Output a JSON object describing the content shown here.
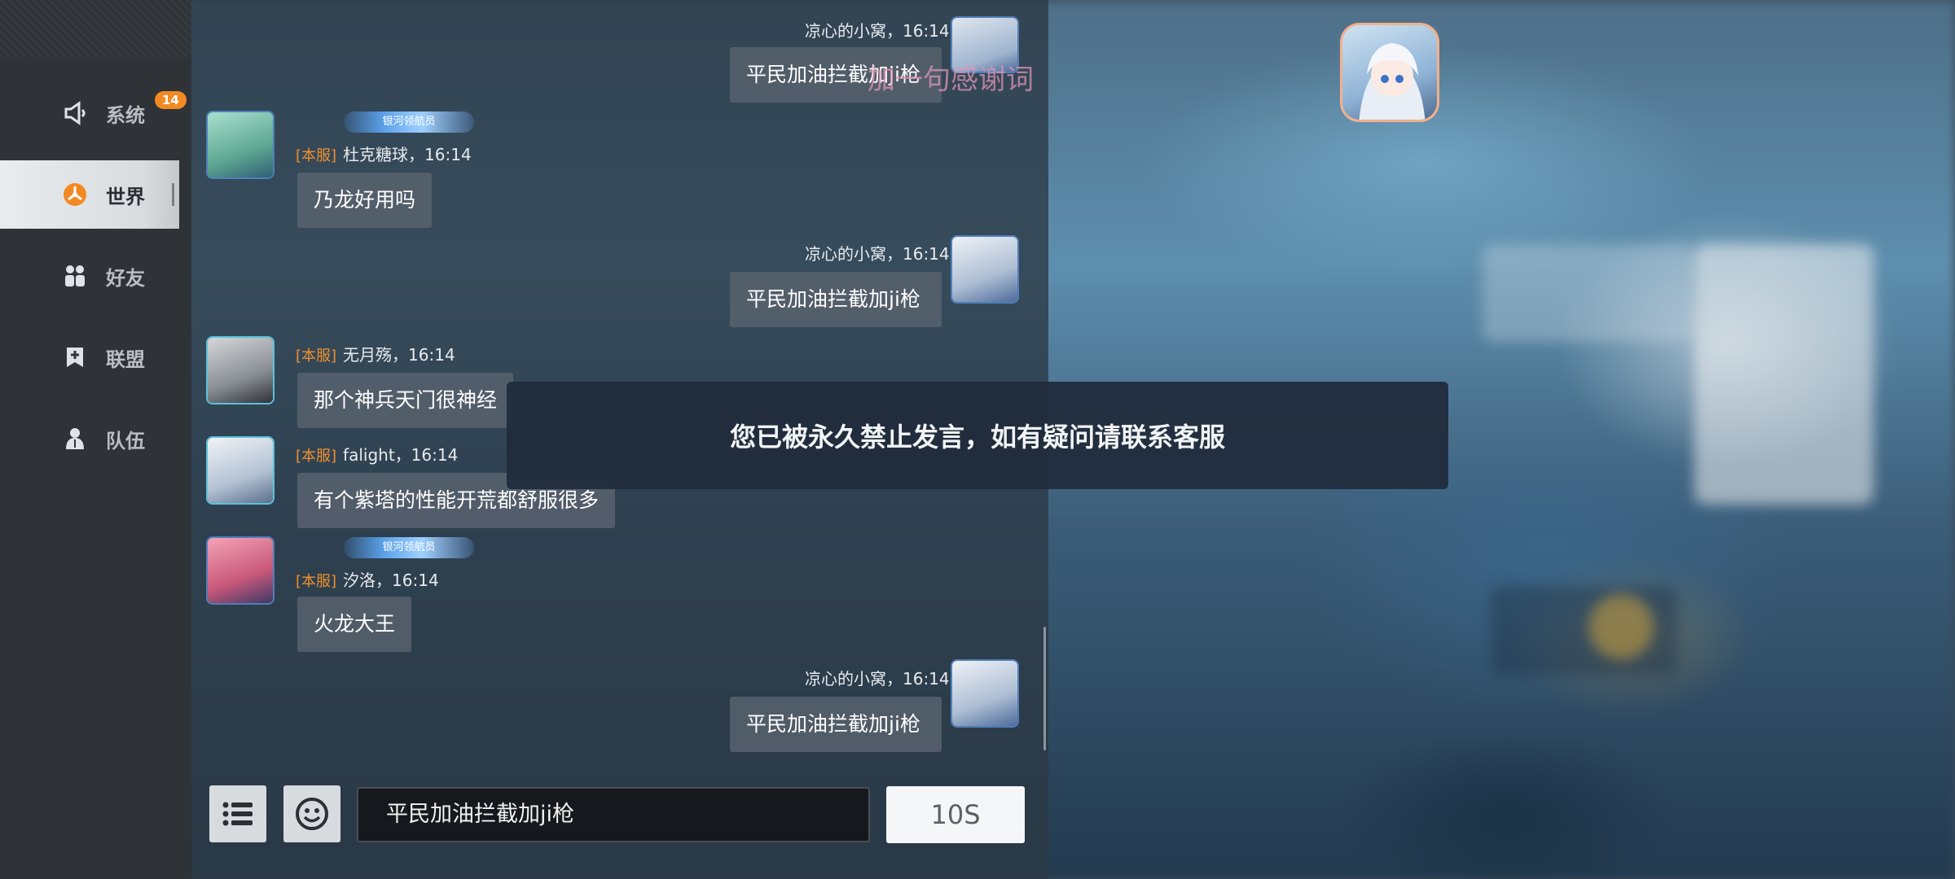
{
  "sidebar": {
    "items": [
      {
        "label": "系统",
        "icon": "speaker-icon",
        "badge": "14"
      },
      {
        "label": "世界",
        "icon": "world-icon",
        "active": true
      },
      {
        "label": "好友",
        "icon": "friends-icon"
      },
      {
        "label": "联盟",
        "icon": "alliance-icon"
      },
      {
        "label": "队伍",
        "icon": "team-icon"
      }
    ]
  },
  "overlay_text": "加一句感谢词",
  "messages": [
    {
      "meta": "凉心的小窝，16:14",
      "text": "平民加油拦截加ji枪",
      "side": "right"
    },
    {
      "tag": "[本服]",
      "meta": "杜克糖球，16:14",
      "text": "乃龙好用吗",
      "side": "left",
      "title_badge": "银河领航员"
    },
    {
      "meta": "凉心的小窝，16:14",
      "text": "平民加油拦截加ji枪",
      "side": "right"
    },
    {
      "tag": "[本服]",
      "meta": "无月殇，16:14",
      "text": "那个神兵天门很神经",
      "side": "left"
    },
    {
      "tag": "[本服]",
      "meta": "falight，16:14",
      "text": "有个紫塔的性能开荒都舒服很多",
      "side": "left"
    },
    {
      "tag": "[本服]",
      "meta": "汐洛，16:14",
      "text": "火龙大王",
      "side": "left",
      "title_badge": "银河领航员"
    },
    {
      "meta": "凉心的小窝，16:14",
      "text": "平民加油拦截加ji枪",
      "side": "right"
    }
  ],
  "toast": "您已被永久禁止发言，如有疑问请联系客服",
  "input": {
    "value": "平民加油拦截加ji枪"
  },
  "send_button": "10S",
  "colors": {
    "accent": "#f28a24",
    "tag": "#f0902e",
    "sidebar_bg": "#2f3338"
  }
}
